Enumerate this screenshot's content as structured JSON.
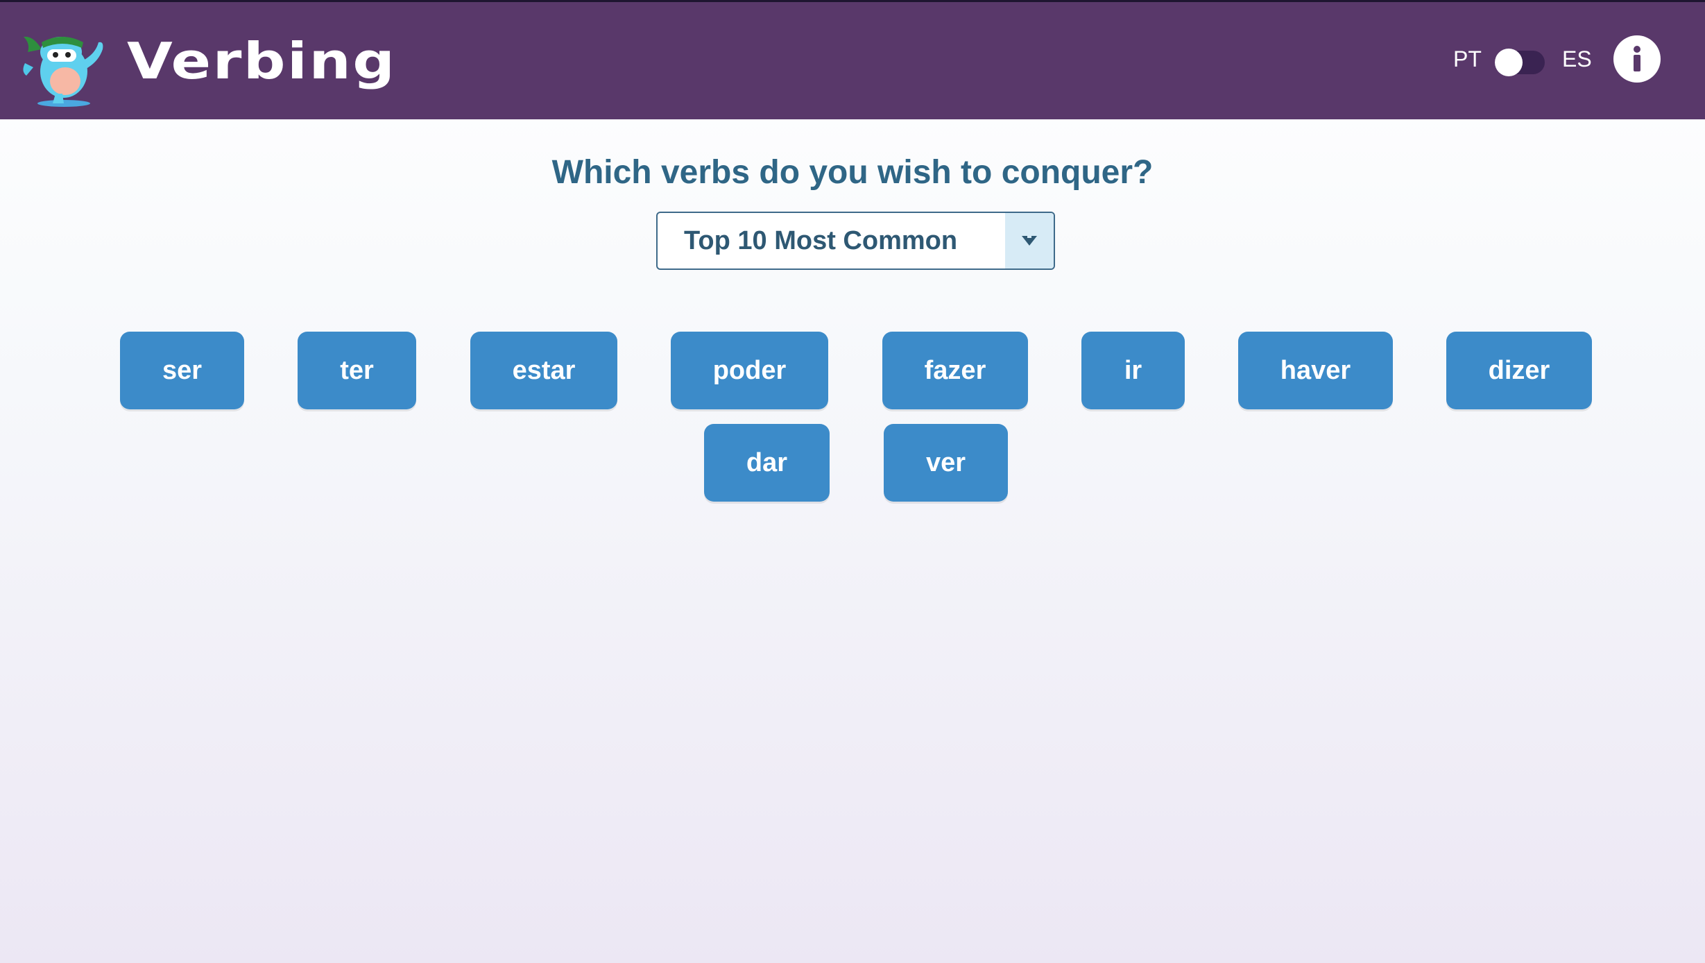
{
  "app": {
    "name": "Verbing",
    "logo_icon": "ninja-mascot-icon"
  },
  "language_toggle": {
    "left_label": "PT",
    "right_label": "ES",
    "active": "PT"
  },
  "info_button": {
    "icon": "info-icon",
    "glyph": "i"
  },
  "prompt": {
    "question": "Which verbs do you wish to conquer?"
  },
  "verb_set_select": {
    "selected": "Top 10 Most Common",
    "arrow_icon": "triangle-down-icon"
  },
  "verbs": [
    {
      "label": "ser"
    },
    {
      "label": "ter"
    },
    {
      "label": "estar"
    },
    {
      "label": "poder"
    },
    {
      "label": "fazer"
    },
    {
      "label": "ir"
    },
    {
      "label": "haver"
    },
    {
      "label": "dizer"
    },
    {
      "label": "dar"
    },
    {
      "label": "ver"
    }
  ],
  "colors": {
    "header": "#59386a",
    "heading": "#2f6686",
    "verb_button": "#3c8bc9"
  }
}
